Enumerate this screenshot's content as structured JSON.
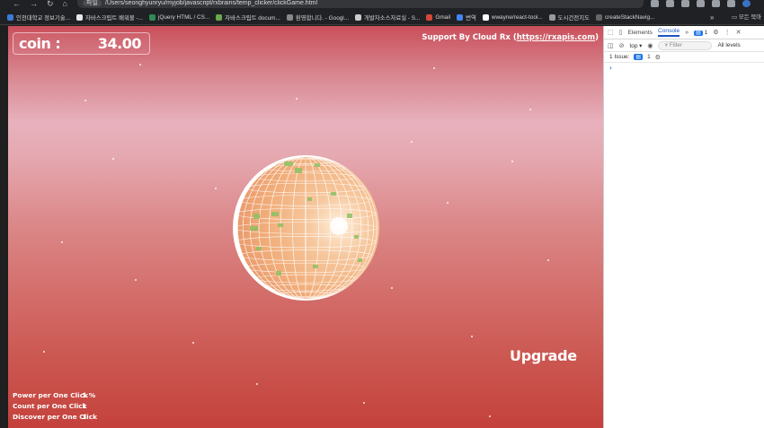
{
  "browser": {
    "url_chip": "파일",
    "url": "/Users/seonghyunryu/myjob/javascript/rxbrains/temp_clicker/clickGame.html",
    "bookmarks": [
      {
        "label": "인천대학교 정보기술...",
        "color": "#3a7bd5"
      },
      {
        "label": "자바스크립트 배워볼 -...",
        "color": "#e8e8e8"
      },
      {
        "label": "jQuery HTML / CS...",
        "color": "#2e8b57"
      },
      {
        "label": "자바스크립트 docum...",
        "color": "#6aa84f"
      },
      {
        "label": "환영합니다. - Googl...",
        "color": "#888888"
      },
      {
        "label": "개발자소스자료실 - S...",
        "color": "#cccccc"
      },
      {
        "label": "Gmail",
        "color": "#d44638"
      },
      {
        "label": "번역",
        "color": "#4285f4"
      },
      {
        "label": "wwayne/react-tool...",
        "color": "#ffffff"
      },
      {
        "label": "도시건전지도",
        "color": "#999999"
      },
      {
        "label": "createStackNavig...",
        "color": "#666666"
      }
    ],
    "more_label": "»",
    "folder_label": "모든 북마"
  },
  "game": {
    "coin_label": "coin :",
    "coin_value": "34.00",
    "support_prefix": "Support By Cloud Rx (",
    "support_link": "https://rxapis.com",
    "support_suffix": ")",
    "upgrade_label": "Upgrade",
    "stats": [
      {
        "label": "Power per One Click",
        "value": "1 %"
      },
      {
        "label": "Count per One Click",
        "value": "1"
      },
      {
        "label": "Discover per One Click",
        "value": "1"
      }
    ]
  },
  "devtools": {
    "tabs": [
      "Elements",
      "Console"
    ],
    "active_tab": "Console",
    "more_tabs": "»",
    "message_count": "1",
    "context": "top",
    "filter_placeholder": "Filter",
    "levels": "All levels",
    "issues_label": "1 Issue:",
    "issues_count": "1",
    "prompt": "›"
  },
  "colors": {
    "accent": "#1a73e8",
    "sphere_grid": "#f4a56a",
    "sphere_green": "#7fbf5a",
    "sky_top": "#c94f5b",
    "sky_bottom": "#c4413c"
  }
}
